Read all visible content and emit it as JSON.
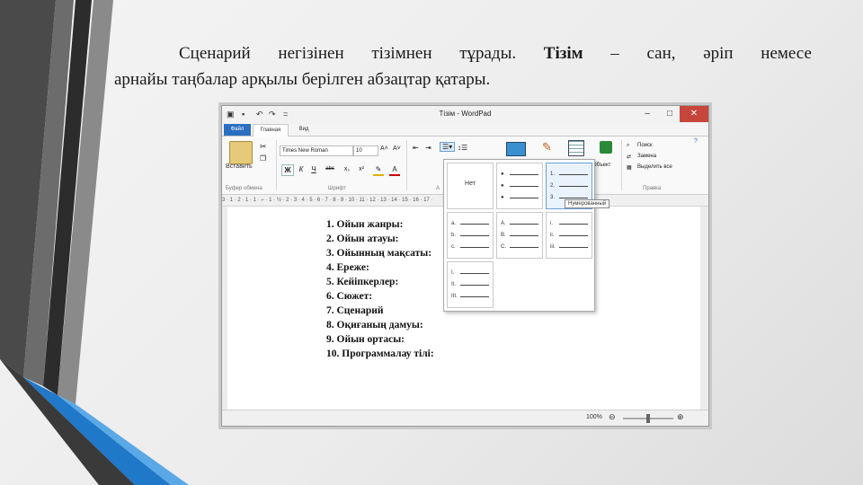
{
  "paragraph": {
    "words_line1": [
      "Сценарий",
      "негізінен",
      "тізімнен",
      "тұрады."
    ],
    "bold_term": "Тізім",
    "words_line1_rest": [
      "–",
      "сан,",
      "әріп",
      "немесе"
    ],
    "line2": "арнайы таңбалар арқылы берілген абзацтар қатары."
  },
  "window": {
    "title": "Тізім - WordPad",
    "quick_access": [
      "▣",
      "▪",
      "↶",
      "↷",
      "="
    ],
    "controls": {
      "minimize": "–",
      "maximize": "□",
      "close": "✕"
    }
  },
  "tabs": {
    "file": "Файл",
    "home": "Главная",
    "view": "Вид"
  },
  "ribbon": {
    "paste_label": "Вставить",
    "font_name": "Times New Roman",
    "font_size": "10",
    "format_buttons": [
      "Ж",
      "К",
      "Ч",
      "abc",
      "x₂",
      "x²",
      "A"
    ],
    "object_label": "Объект",
    "find_label": "Поиск",
    "replace_label": "Замена",
    "select_all_label": "Выделить все",
    "groups": {
      "clipboard": "Буфер обмена",
      "font": "Шрифт",
      "paragraph": "А",
      "edit": "Правка"
    }
  },
  "ruler_text": "3 · 1 · 2 · 1 · 1 · ⌐ · 1 · ½ · 2 · 3 · 4 · 5 · 6 · 7 · 8 · 9 · 10 · 11 · 12 · 13 · 14 · 15 · 16 · 17 ·",
  "list_dropdown": {
    "none_label": "Нет",
    "bullets": [
      "●",
      "●",
      "●"
    ],
    "numbers": [
      "1.",
      "2.",
      "3."
    ],
    "lower_alpha": [
      "a.",
      "b.",
      "c."
    ],
    "upper_alpha": [
      "A.",
      "B.",
      "C."
    ],
    "lower_roman": [
      "i.",
      "ii.",
      "iii."
    ],
    "upper_roman": [
      "I.",
      "II.",
      "III."
    ],
    "tooltip": "Нумерованный"
  },
  "document_items": [
    "1. Ойын  жанры:",
    "2. Ойын атауы:",
    "3. Ойынның мақсаты:",
    "4. Ереже:",
    "5. Кейіпкерлер:",
    "6. Сюжет:",
    "7. Сценарий",
    "8. Оқиғаның дамуы:",
    "9. Ойын ортасы:",
    "10. Программалау тілі:"
  ],
  "status": {
    "zoom": "100%",
    "zoom_fraction": 0.5
  }
}
